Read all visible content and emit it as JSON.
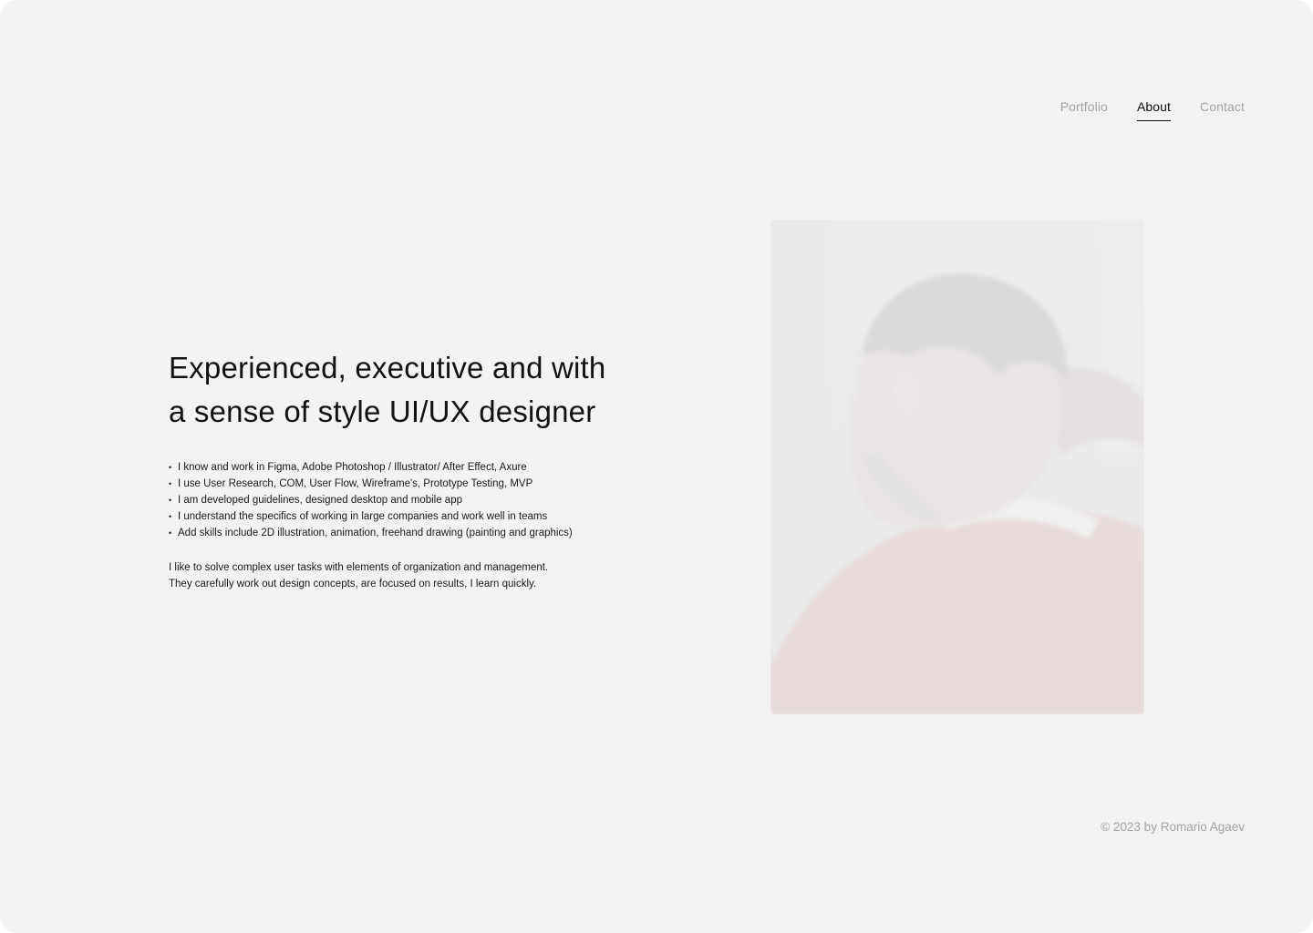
{
  "nav": {
    "items": [
      {
        "label": "Portfolio",
        "active": false
      },
      {
        "label": "About",
        "active": true
      },
      {
        "label": "Contact",
        "active": false
      }
    ]
  },
  "hero": {
    "headline_line1": "Experienced, executive and with",
    "headline_line2": "a sense of style UI/UX designer"
  },
  "skills": [
    "I know and work in Figma, Adobe Photoshop / Illustrator/ After Effect, Axure",
    "I use User Research, COM, User Flow, Wireframe's, Prototype Testing, MVP",
    "I am developed guidelines, designed desktop and mobile app",
    "I understand the specifics of working in large companies and work well in teams",
    "Add skills include 2D illustration, animation, freehand drawing (painting and graphics)"
  ],
  "about": {
    "line1": "I like to solve complex user tasks with elements of organization and management.",
    "line2": "They carefully work out design concepts, are focused on results, I learn quickly."
  },
  "footer": {
    "copyright": "© 2023 by Romario Agaev"
  },
  "colors": {
    "background": "#f3f3f3",
    "text": "#111111",
    "muted": "#a3a3a3"
  }
}
